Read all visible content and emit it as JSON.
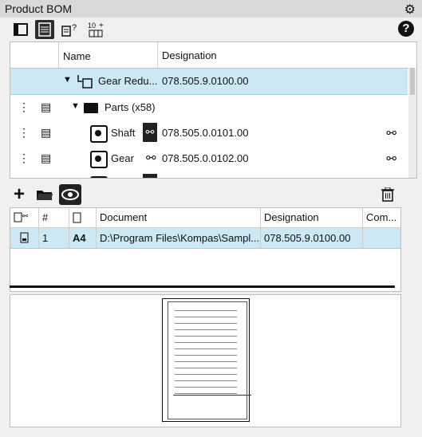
{
  "window": {
    "title": "Product BOM"
  },
  "tree": {
    "columns": [
      "Name",
      "Designation"
    ],
    "rows": [
      {
        "name": "Gear Redu...",
        "designation": "078.505.9.0100.00"
      },
      {
        "name": "Parts (x58)",
        "designation": ""
      },
      {
        "name": "Shaft",
        "designation": "078.505.0.0101.00"
      },
      {
        "name": "Gear",
        "designation": "078.505.0.0102.00"
      }
    ]
  },
  "docs": {
    "columns": [
      "#",
      "Document",
      "Designation",
      "Com..."
    ],
    "rows": [
      {
        "num": "1",
        "format": "A4",
        "document": "D:\\Program Files\\Kompas\\Sampl...",
        "designation": "078.505.9.0100.00",
        "comment": ""
      }
    ]
  },
  "toolbar1": {
    "counter_label": "10"
  },
  "colors": {
    "selection": "#cce8f4",
    "active_button": "#2d2d2d"
  }
}
